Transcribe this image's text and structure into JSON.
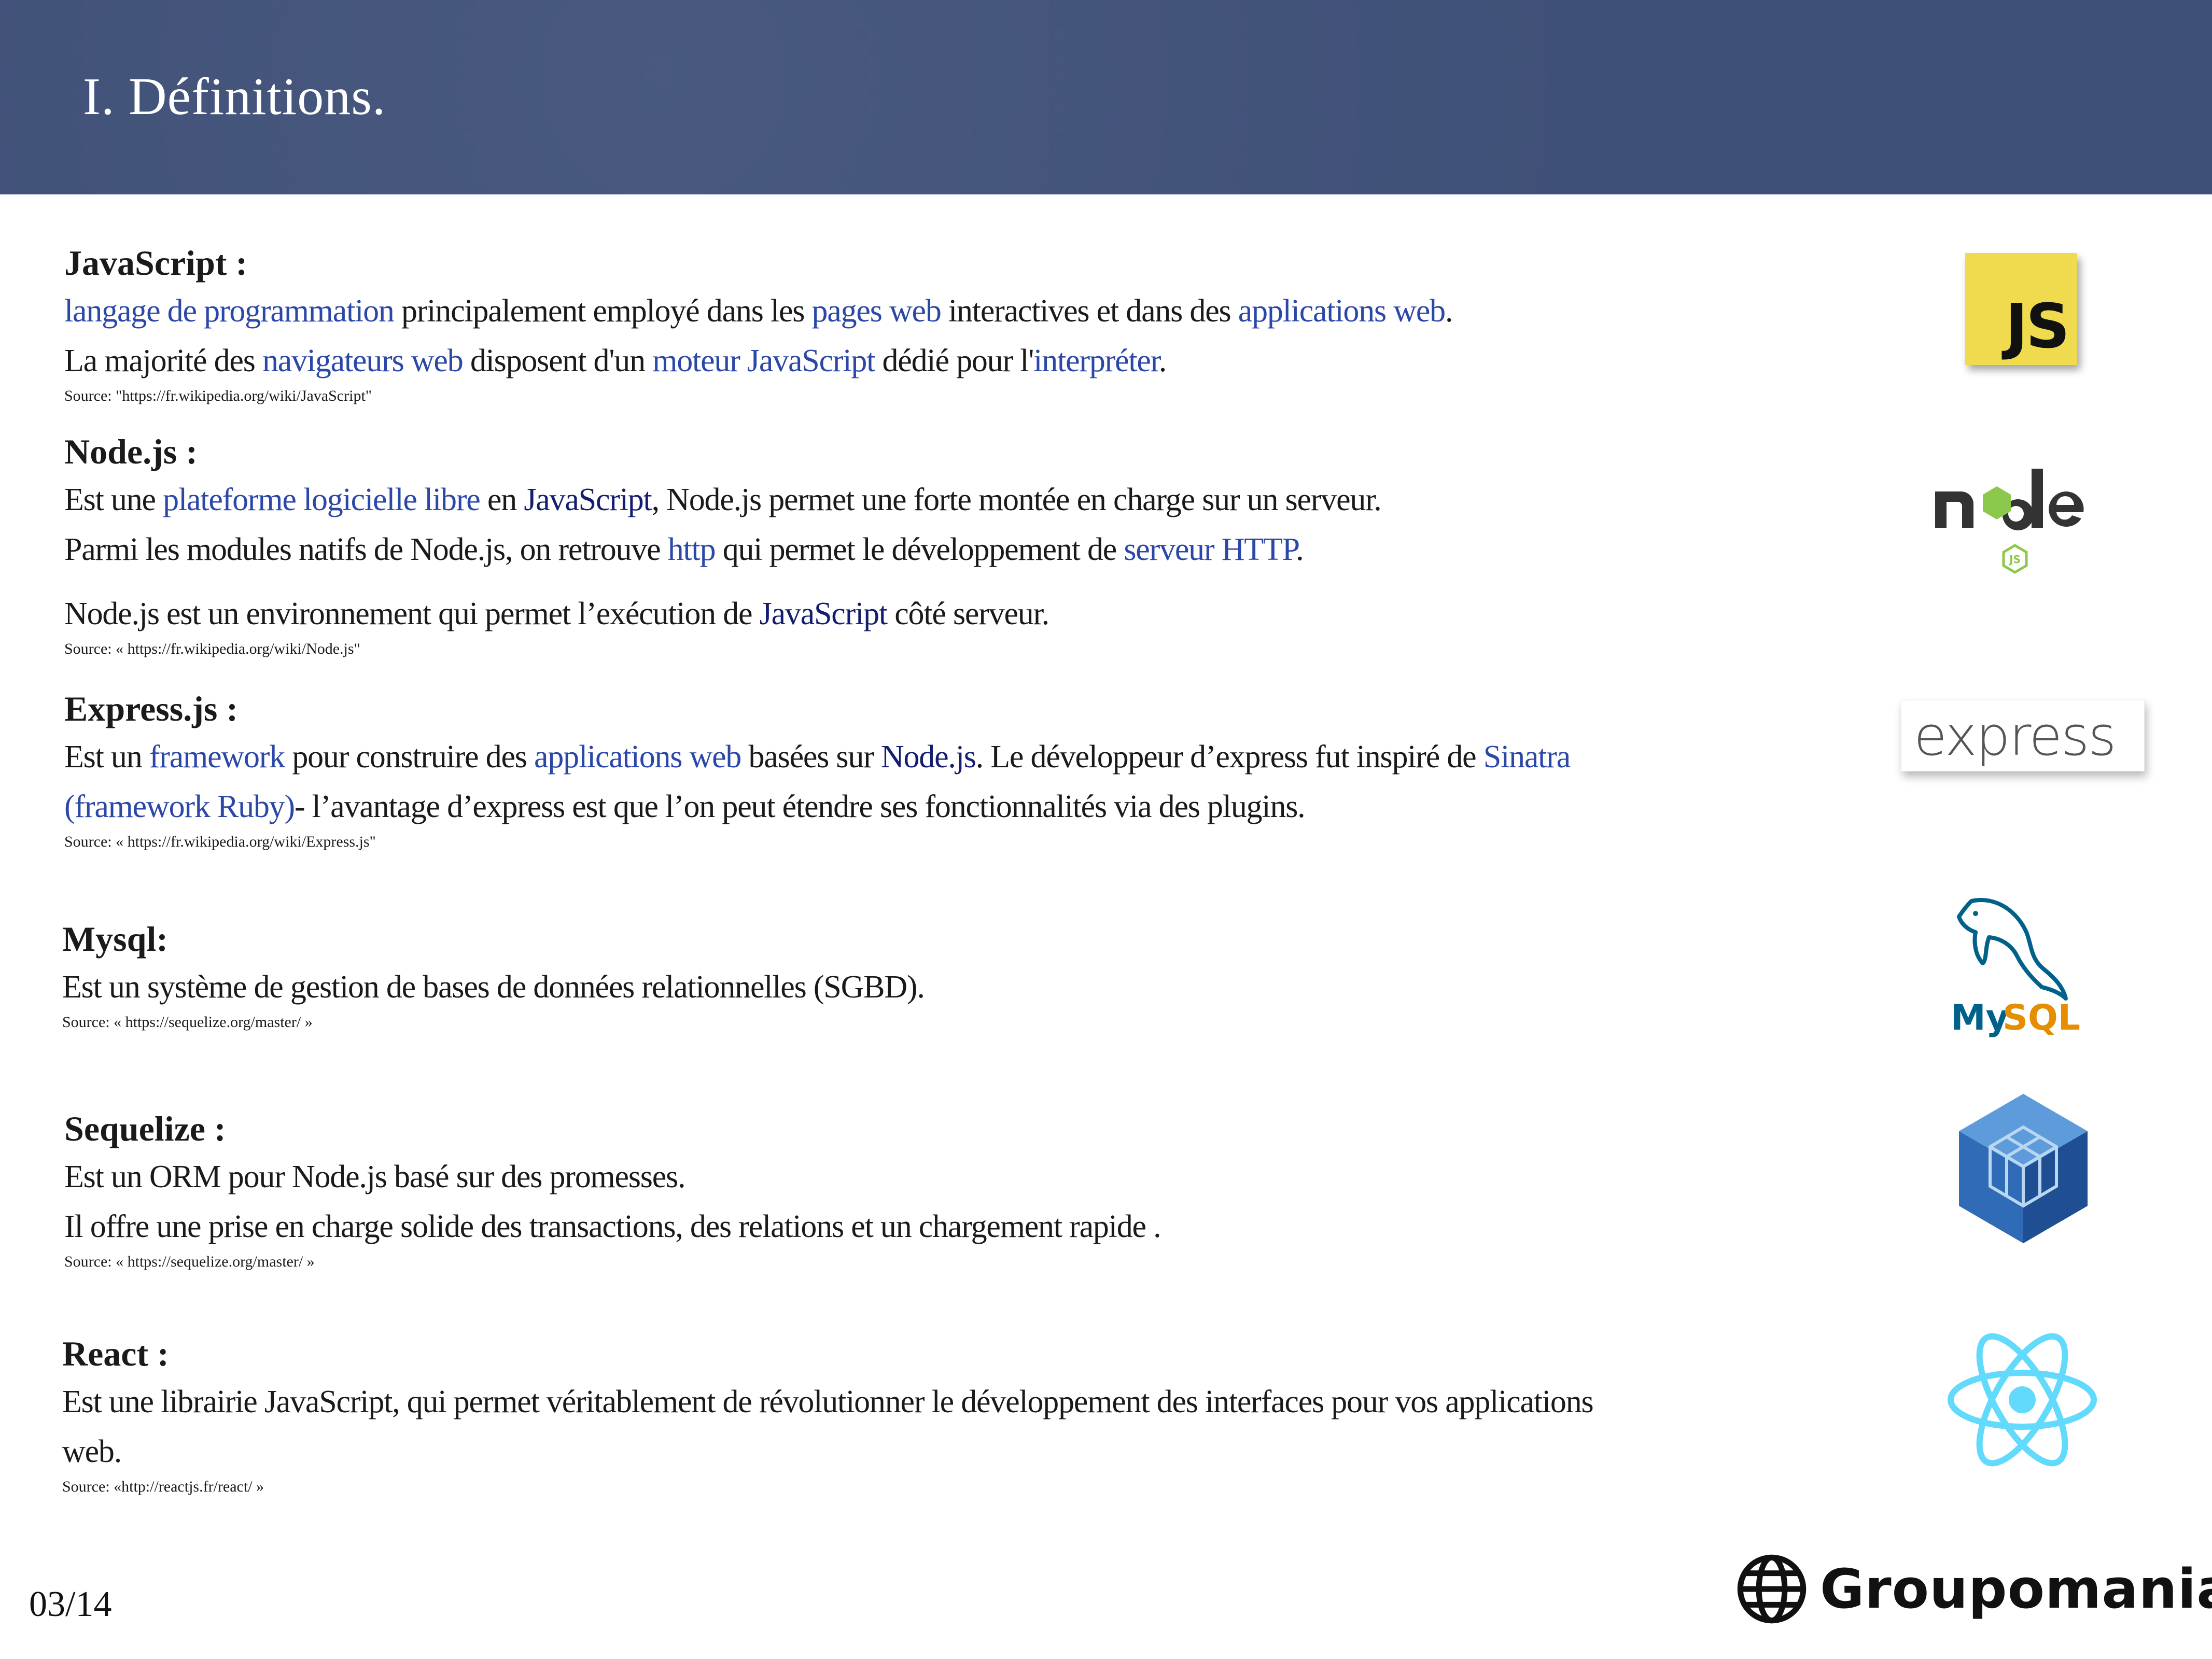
{
  "header": {
    "title": "I. Définitions."
  },
  "sections": {
    "javascript": {
      "heading": "JavaScript",
      "colon": " :",
      "line1": [
        {
          "t": "langage de programmation",
          "link": true
        },
        {
          "t": " principalement employé dans les "
        },
        {
          "t": "pages web",
          "link": true
        },
        {
          "t": " interactives et dans des "
        },
        {
          "t": "applications web",
          "link": true
        },
        {
          "t": "."
        }
      ],
      "line2": [
        {
          "t": "La majorité des "
        },
        {
          "t": "navigateurs web",
          "link": true
        },
        {
          "t": " disposent d'un "
        },
        {
          "t": "moteur JavaScript",
          "link": true
        },
        {
          "t": " dédié pour l'"
        },
        {
          "t": "interpréter",
          "link": true
        },
        {
          "t": "."
        }
      ],
      "source": "Source: \"https://fr.wikipedia.org/wiki/JavaScript\""
    },
    "nodejs": {
      "heading": "Node.js",
      "colon": " :",
      "line1": [
        {
          "t": "Est une "
        },
        {
          "t": "plateforme logicielle libre",
          "link": true
        },
        {
          "t": " en "
        },
        {
          "t": "JavaScript",
          "link": "dark"
        },
        {
          "t": ", Node.js  permet une forte montée en charge sur un serveur."
        }
      ],
      "line2": [
        {
          "t": "Parmi les modules natifs de Node.js, on retrouve "
        },
        {
          "t": "http",
          "link": true
        },
        {
          "t": " qui permet le développement de "
        },
        {
          "t": "serveur HTTP",
          "link": true
        },
        {
          "t": "."
        }
      ],
      "line3": [
        {
          "t": "Node.js est un environnement qui permet l’exécution de "
        },
        {
          "t": "JavaScript",
          "link": "dark"
        },
        {
          "t": " côté serveur."
        }
      ],
      "source": "Source: « https://fr.wikipedia.org/wiki/Node.js\""
    },
    "express": {
      "heading": "Express.js",
      "colon": " :",
      "line1": [
        {
          "t": "Est un "
        },
        {
          "t": "framework",
          "link": true
        },
        {
          "t": " pour construire des "
        },
        {
          "t": "applications web",
          "link": true
        },
        {
          "t": " basées sur "
        },
        {
          "t": "Node.js",
          "link": "dark"
        },
        {
          "t": ". Le développeur d’express fut inspiré de "
        },
        {
          "t": "Sinatra",
          "link": true
        }
      ],
      "line2": [
        {
          "t": "(framework Ruby)",
          "link": true
        },
        {
          "t": "-  l’avantage d’express est que l’on peut étendre ses fonctionnalités via des plugins."
        }
      ],
      "source": "Source: « https://fr.wikipedia.org/wiki/Express.js\""
    },
    "mysql": {
      "heading": "Mysql",
      "colon": ":",
      "line1": [
        {
          "t": "Est un système de gestion de bases de données relationnelles (SGBD)."
        }
      ],
      "source": "Source: « https://sequelize.org/master/ »"
    },
    "sequelize": {
      "heading": "Sequelize",
      "colon": "  :",
      "line1": [
        {
          "t": "Est un ORM pour Node.js basé sur des promesses."
        }
      ],
      "line2": [
        {
          "t": "Il offre une prise en charge solide des transactions, des relations et un chargement rapide ."
        }
      ],
      "source": "Source: « https://sequelize.org/master/ »"
    },
    "react": {
      "heading": "React",
      "colon": "  :",
      "line1": [
        {
          "t": "Est une librairie JavaScript, qui permet véritablement de révolutionner le développement des interfaces pour vos applications"
        }
      ],
      "line2": [
        {
          "t": "web."
        }
      ],
      "source": "Source: «http://reactjs.fr/react/ »"
    }
  },
  "logos": {
    "js": {
      "text": "JS",
      "icon": "javascript-logo",
      "bg": "#f0db4f"
    },
    "node": {
      "text": "node",
      "sub": "JS",
      "icon": "nodejs-logo",
      "color_dark": "#333333",
      "color_green": "#8cc84b"
    },
    "express": {
      "text": "express",
      "icon": "express-logo"
    },
    "mysql": {
      "text_my": "My",
      "text_sql": "SQL",
      "icon": "mysql-dolphin-logo",
      "color_blue": "#00618a",
      "color_orange": "#e48e00"
    },
    "sequelize": {
      "icon": "sequelize-cube-logo",
      "color": "#2f6bb7"
    },
    "react": {
      "icon": "react-atom-logo",
      "color": "#61dafb"
    }
  },
  "footer": {
    "page": "03/14",
    "brand": "Groupomania",
    "brand_icon": "globe-icon"
  },
  "colors": {
    "header_bg": "#3f5078",
    "link": "#2b47a8",
    "link_dark": "#141e70"
  }
}
